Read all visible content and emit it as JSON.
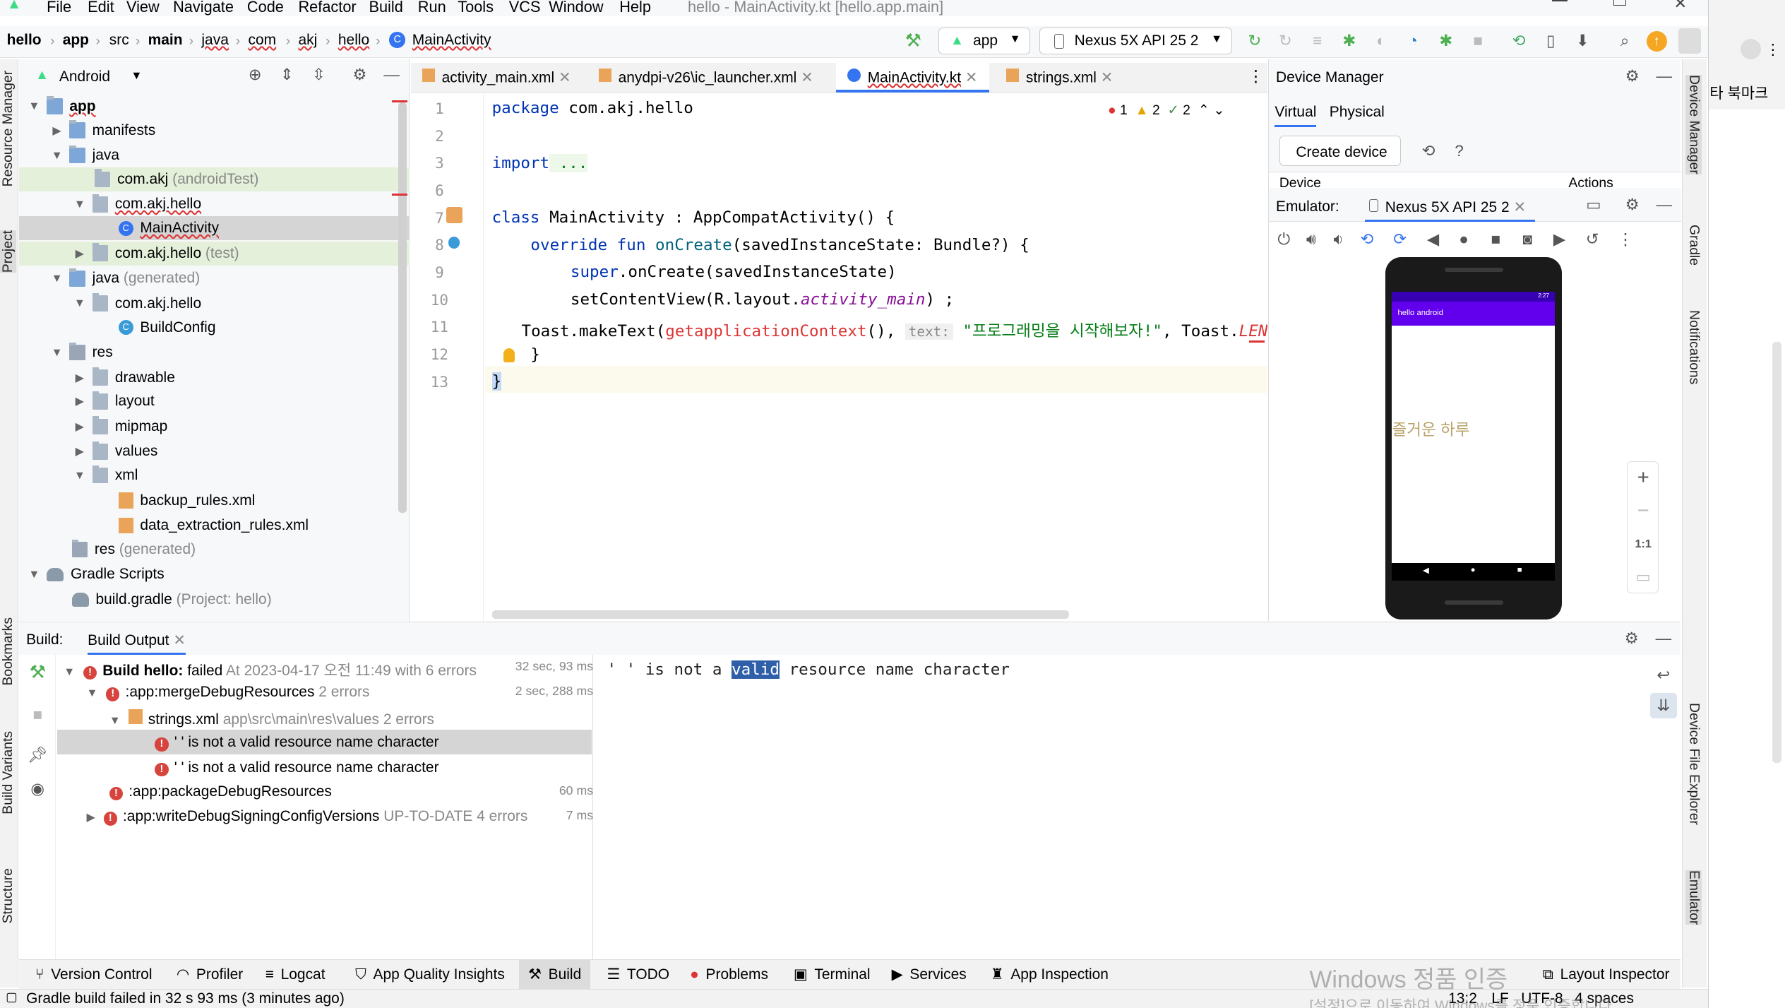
{
  "menu": {
    "file": "File",
    "edit": "Edit",
    "view": "View",
    "navigate": "Navigate",
    "code": "Code",
    "refactor": "Refactor",
    "build": "Build",
    "run": "Run",
    "tools": "Tools",
    "vcs": "VCS",
    "window": "Window",
    "help": "Help",
    "title": "hello - MainActivity.kt [hello.app.main]"
  },
  "breadcrumb": {
    "b1": "hello",
    "b2": "app",
    "b3": "src",
    "b4": "main",
    "b5": "java",
    "b6": "com",
    "b7": "akj",
    "b8": "hello",
    "b9": "MainActivity"
  },
  "toolbar": {
    "run_config": "app",
    "device": "Nexus 5X API 25 2"
  },
  "project": {
    "view_mode": "Android",
    "items": [
      {
        "label": "app"
      },
      {
        "label": "manifests"
      },
      {
        "label": "java"
      },
      {
        "label": "com.akj",
        "suffix": "(androidTest)"
      },
      {
        "label": "com.akj.hello"
      },
      {
        "label": "MainActivity"
      },
      {
        "label": "com.akj.hello",
        "suffix": "(test)"
      },
      {
        "label": "java",
        "suffix": "(generated)"
      },
      {
        "label": "com.akj.hello"
      },
      {
        "label": "BuildConfig"
      },
      {
        "label": "res"
      },
      {
        "label": "drawable"
      },
      {
        "label": "layout"
      },
      {
        "label": "mipmap"
      },
      {
        "label": "values"
      },
      {
        "label": "xml"
      },
      {
        "label": "backup_rules.xml"
      },
      {
        "label": "data_extraction_rules.xml"
      },
      {
        "label": "res",
        "suffix": "(generated)"
      },
      {
        "label": "Gradle Scripts"
      },
      {
        "label": "build.gradle",
        "suffix": "(Project: hello)"
      }
    ]
  },
  "editor": {
    "tabs": [
      "activity_main.xml",
      "anydpi-v26\\ic_launcher.xml",
      "MainActivity.kt",
      "strings.xml"
    ],
    "inspections": {
      "errors": "1",
      "warnings": "2",
      "weak": "2"
    },
    "line_numbers": [
      "1",
      "2",
      "3",
      "6",
      "7",
      "8",
      "9",
      "10",
      "11",
      "12",
      "13"
    ],
    "code": {
      "l1_kw": "package",
      "l1_rest": " com.akj.hello",
      "l3_kw": "import",
      "l3_rest": " ...",
      "l7_kw": "class",
      "l7_rest": " MainActivity : AppCompatActivity() {",
      "l8_kw": "override fun",
      "l8_fn": " onCreate",
      "l8_rest": "(savedInstanceState: Bundle?) {",
      "l9_kw": "super",
      "l9_rest": ".onCreate(savedInstanceState)",
      "l10_a": "setContentView(R.layout.",
      "l10_it": "activity_main",
      "l10_b": ") ;",
      "l11_a": "Toast.makeText(",
      "l11_err": "getapplicationContext",
      "l11_b": "(), ",
      "l11_hint": "text:",
      "l11_str": "\"프로그래밍을 시작해보자!\"",
      "l11_c": ", Toast.",
      "l11_d": "LEN",
      "l12": "}",
      "l13": "}"
    }
  },
  "device_manager": {
    "title": "Device Manager",
    "tab_virtual": "Virtual",
    "tab_physical": "Physical",
    "create_button": "Create device",
    "col_device": "Device",
    "col_actions": "Actions"
  },
  "emulator": {
    "label": "Emulator:",
    "tab": "Nexus 5X API 25 2",
    "app_title": "hello android",
    "status_time": "2:27",
    "content_text": "즐거운 하루",
    "zoom_fit": "1:1"
  },
  "build": {
    "label": "Build:",
    "tab": "Build Output",
    "rows": [
      {
        "bold": "Build hello:",
        "text": " failed",
        "meta": " At 2023-04-17 오전 11:49 with 6 errors",
        "time": "32 sec, 93 ms"
      },
      {
        "text": ":app:mergeDebugResources",
        "meta": " 2 errors",
        "time": "2 sec, 288 ms"
      },
      {
        "text": "strings.xml",
        "meta": " app\\src\\main\\res\\values 2 errors",
        "time": ""
      },
      {
        "text": "' ' is not a valid resource name character",
        "meta": "",
        "time": ""
      },
      {
        "text": "' ' is not a valid resource name character",
        "meta": "",
        "time": ""
      },
      {
        "text": ":app:packageDebugResources",
        "meta": "",
        "time": "60 ms"
      },
      {
        "text": ":app:writeDebugSigningConfigVersions",
        "meta": " UP-TO-DATE 4 errors",
        "time": "7 ms"
      }
    ],
    "detail_a": "' ' is not a ",
    "detail_sel": "valid",
    "detail_b": " resource name character"
  },
  "bottom_tabs": [
    "Version Control",
    "Profiler",
    "Logcat",
    "App Quality Insights",
    "Build",
    "TODO",
    "Problems",
    "Terminal",
    "Services",
    "App Inspection",
    "Layout Inspector"
  ],
  "status": {
    "message": "Gradle build failed in 32 s 93 ms (3 minutes ago)",
    "position": "13:2",
    "line_sep": "LF",
    "encoding": "UTF-8",
    "indent": "4 spaces"
  },
  "watermark": {
    "line1": "Windows 정품 인증",
    "line2": "[설정]으로 이동하여 Windows를 정품 인증합니다."
  },
  "left_strip": [
    "Resource Manager",
    "Project",
    "Bookmarks",
    "Build Variants",
    "Structure"
  ],
  "right_strip": [
    "Device Manager",
    "Gradle",
    "Notifications",
    "Device File Explorer",
    "Emulator"
  ],
  "browser_peek": {
    "bookmarks": "타 북마크"
  },
  "colors": {
    "accent": "#3574f0",
    "error": "#d7443e",
    "android_purple": "#6200ee",
    "selection": "#d5d5d5"
  }
}
